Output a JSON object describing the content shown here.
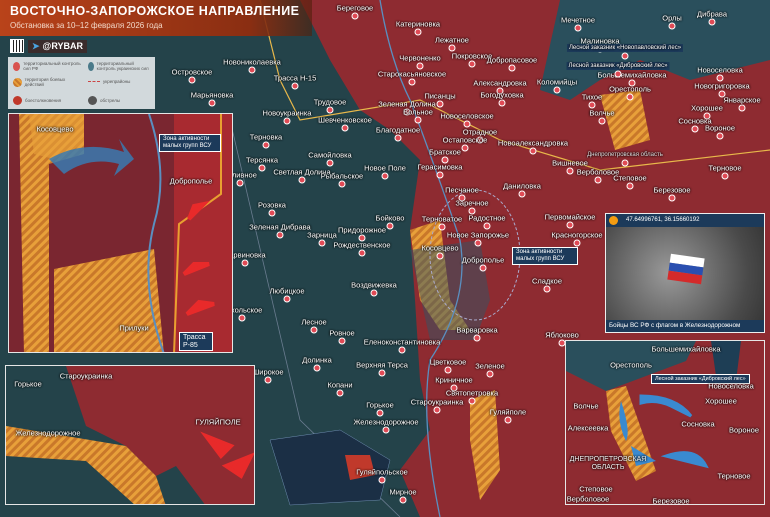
{
  "header": {
    "title": "ВОСТОЧНО-ЗАПОРОЖСКОЕ НАПРАВЛЕНИЕ",
    "subtitle": "Обстановка за 10–12 февраля 2026 года"
  },
  "brand": {
    "handle": "@RYBAR"
  },
  "legend": {
    "rf_control": "территориальный контроль сил РФ",
    "ua_control": "территориальный контроль украинских сил",
    "combat_area": "территория боевых действий",
    "fortified": "укрепрайоны",
    "clashes": "боестолкновения",
    "shelling": "обстрелы"
  },
  "colors": {
    "rf": "#8e2b31",
    "ua": "#2c5a6a",
    "combat": "#e0902a",
    "accent": "#b9431a",
    "arrow_ua": "#3a8ad0",
    "arrow_rf": "#e02a2a"
  },
  "photo": {
    "coords": "47.64996761, 36.15660192",
    "caption": "Бойцы ВС РФ с флагом в Железнодорожном"
  },
  "main_towns": [
    "Береговое",
    "Катериновка",
    "Лежатное",
    "Мечетное",
    "Орлы",
    "Дибрава",
    "Малиновка",
    "Новониколаевка",
    "Островское",
    "Марьяновка",
    "Трасса Н-15",
    "Старокасьяновское",
    "Червоненко",
    "Покровское",
    "Добропасовое",
    "Александровка",
    "Богодуховка",
    "Коломийцы",
    "Большемихайловка",
    "Новоселовка",
    "Тихое",
    "Орестополь",
    "Новогригоровка",
    "Январское",
    "Хорошее",
    "Сосновка",
    "Вороное",
    "Волчье",
    "Новоукраинка",
    "Трудовое",
    "Зеленая Долина",
    "Вольное",
    "Писанцы",
    "Новоселовское",
    "Шевченковское",
    "Благодатное",
    "Отрадное",
    "Остаповское",
    "Новоалександровка",
    "Терновка",
    "Самойловка",
    "Терсянка",
    "Светлая Долина",
    "Заливное",
    "Рыбальское",
    "Новое Поле",
    "Братское",
    "Герасимовка",
    "Вишневое",
    "Днепропетровская область",
    "Верболовое",
    "Степовое",
    "Березовое",
    "Терновое",
    "Песчаное",
    "Даниловка",
    "Заречное",
    "Розовка",
    "Зеленая Дибрава",
    "Зарница",
    "Бойково",
    "Терноватое",
    "Радостное",
    "Новое Запорожье",
    "Первомайское",
    "Красногорское",
    "Доброполье",
    "Придорожное",
    "Рождественское",
    "Барвиновка",
    "Любицкое",
    "Воздвижевка",
    "Сладкое",
    "Никольское",
    "Лесное",
    "Ровное",
    "Варваровка",
    "Яблоково",
    "Еленоконстантиновка",
    "Цветковое",
    "Верхняя Терса",
    "Криничное",
    "Долинка",
    "Широкое",
    "Копани",
    "Зеленое",
    "Горькое",
    "Святопетровка",
    "Староукраинка",
    "Железнодорожное",
    "Гуляйполе",
    "Гуляйпольское",
    "Мирное",
    "Косовцево",
    "Лесной заказник «Новопавловский лес»",
    "Лесной заказник «Дибровский лес»"
  ],
  "zones": {
    "main": "Зона активности малых групп ВСУ",
    "inset": "Зона активности малых групп ВСУ"
  },
  "inset1": {
    "towns": [
      "Косовцево",
      "Доброполье",
      "Прилуки",
      "Трасса Р-85"
    ]
  },
  "inset2": {
    "towns": [
      "Горькое",
      "Староукраинка",
      "Железнодорожное",
      "ГУЛЯЙПОЛЕ"
    ]
  },
  "inset3": {
    "towns": [
      "Большемихайловка",
      "Орестополь",
      "Лесной заказник «Дибровский лес»",
      "Волчье",
      "Новоселовка",
      "Хорошее",
      "Алексеевка",
      "Сосновка",
      "Вороное",
      "ДНЕПРОПЕТРОВСКАЯ ОБЛАСТЬ",
      "Степовое",
      "Терновое",
      "Верболовое",
      "Березовое"
    ]
  }
}
